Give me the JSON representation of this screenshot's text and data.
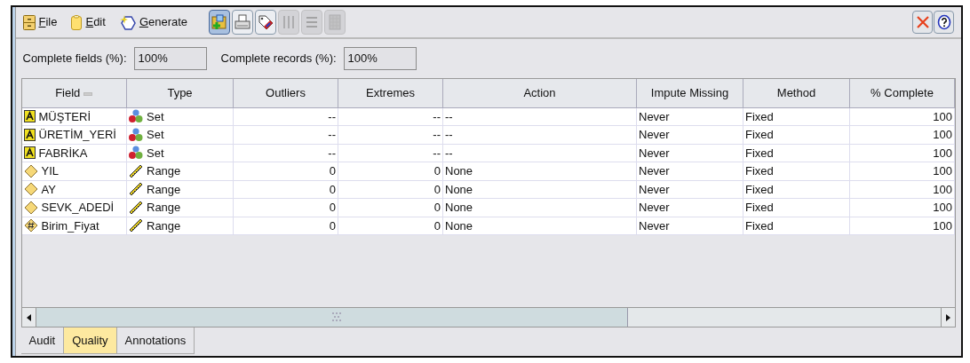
{
  "menu": [
    {
      "label": "File",
      "kind": "file"
    },
    {
      "label": "Edit",
      "kind": "edit"
    },
    {
      "label": "Generate",
      "kind": "generate"
    }
  ],
  "toolbar_buttons": [
    {
      "kind": "add",
      "selected": true,
      "disabled": false
    },
    {
      "kind": "print",
      "selected": false,
      "disabled": false
    },
    {
      "kind": "tag",
      "selected": false,
      "disabled": false
    },
    {
      "kind": "columns",
      "selected": false,
      "disabled": true
    },
    {
      "kind": "rows",
      "selected": false,
      "disabled": true
    },
    {
      "kind": "grid",
      "selected": false,
      "disabled": true
    }
  ],
  "summary": [
    {
      "label": "Complete fields (%):",
      "value": "100%"
    },
    {
      "label": "Complete records (%):",
      "value": "100%"
    }
  ],
  "table": {
    "columns": [
      {
        "label": "Field",
        "sorted": true
      },
      {
        "label": "Type",
        "sorted": false
      },
      {
        "label": "Outliers",
        "sorted": false
      },
      {
        "label": "Extremes",
        "sorted": false
      },
      {
        "label": "Action",
        "sorted": false
      },
      {
        "label": "Impute Missing",
        "sorted": false
      },
      {
        "label": "Method",
        "sorted": false
      },
      {
        "label": "% Complete",
        "sorted": false
      }
    ],
    "rows": [
      {
        "field": {
          "label": "MÜŞTERİ",
          "kind": "string"
        },
        "type": {
          "label": "Set",
          "kind": "set"
        },
        "outliers": "--",
        "extremes": "--",
        "action": "--",
        "impute": "Never",
        "method": "Fixed",
        "complete": "100"
      },
      {
        "field": {
          "label": "ÜRETİM_YERİ",
          "kind": "string"
        },
        "type": {
          "label": "Set",
          "kind": "set"
        },
        "outliers": "--",
        "extremes": "--",
        "action": "--",
        "impute": "Never",
        "method": "Fixed",
        "complete": "100"
      },
      {
        "field": {
          "label": "FABRİKA",
          "kind": "string"
        },
        "type": {
          "label": "Set",
          "kind": "set"
        },
        "outliers": "--",
        "extremes": "--",
        "action": "--",
        "impute": "Never",
        "method": "Fixed",
        "complete": "100"
      },
      {
        "field": {
          "label": "YIL",
          "kind": "integer"
        },
        "type": {
          "label": "Range",
          "kind": "range"
        },
        "outliers": "0",
        "extremes": "0",
        "action": "None",
        "impute": "Never",
        "method": "Fixed",
        "complete": "100"
      },
      {
        "field": {
          "label": "AY",
          "kind": "integer"
        },
        "type": {
          "label": "Range",
          "kind": "range"
        },
        "outliers": "0",
        "extremes": "0",
        "action": "None",
        "impute": "Never",
        "method": "Fixed",
        "complete": "100"
      },
      {
        "field": {
          "label": "SEVK_ADEDİ",
          "kind": "integer"
        },
        "type": {
          "label": "Range",
          "kind": "range"
        },
        "outliers": "0",
        "extremes": "0",
        "action": "None",
        "impute": "Never",
        "method": "Fixed",
        "complete": "100"
      },
      {
        "field": {
          "label": "Birim_Fiyat",
          "kind": "real"
        },
        "type": {
          "label": "Range",
          "kind": "range"
        },
        "outliers": "0",
        "extremes": "0",
        "action": "None",
        "impute": "Never",
        "method": "Fixed",
        "complete": "100"
      }
    ]
  },
  "tabs": [
    {
      "label": "Audit",
      "selected": false
    },
    {
      "label": "Quality",
      "selected": true
    },
    {
      "label": "Annotations",
      "selected": false
    }
  ]
}
